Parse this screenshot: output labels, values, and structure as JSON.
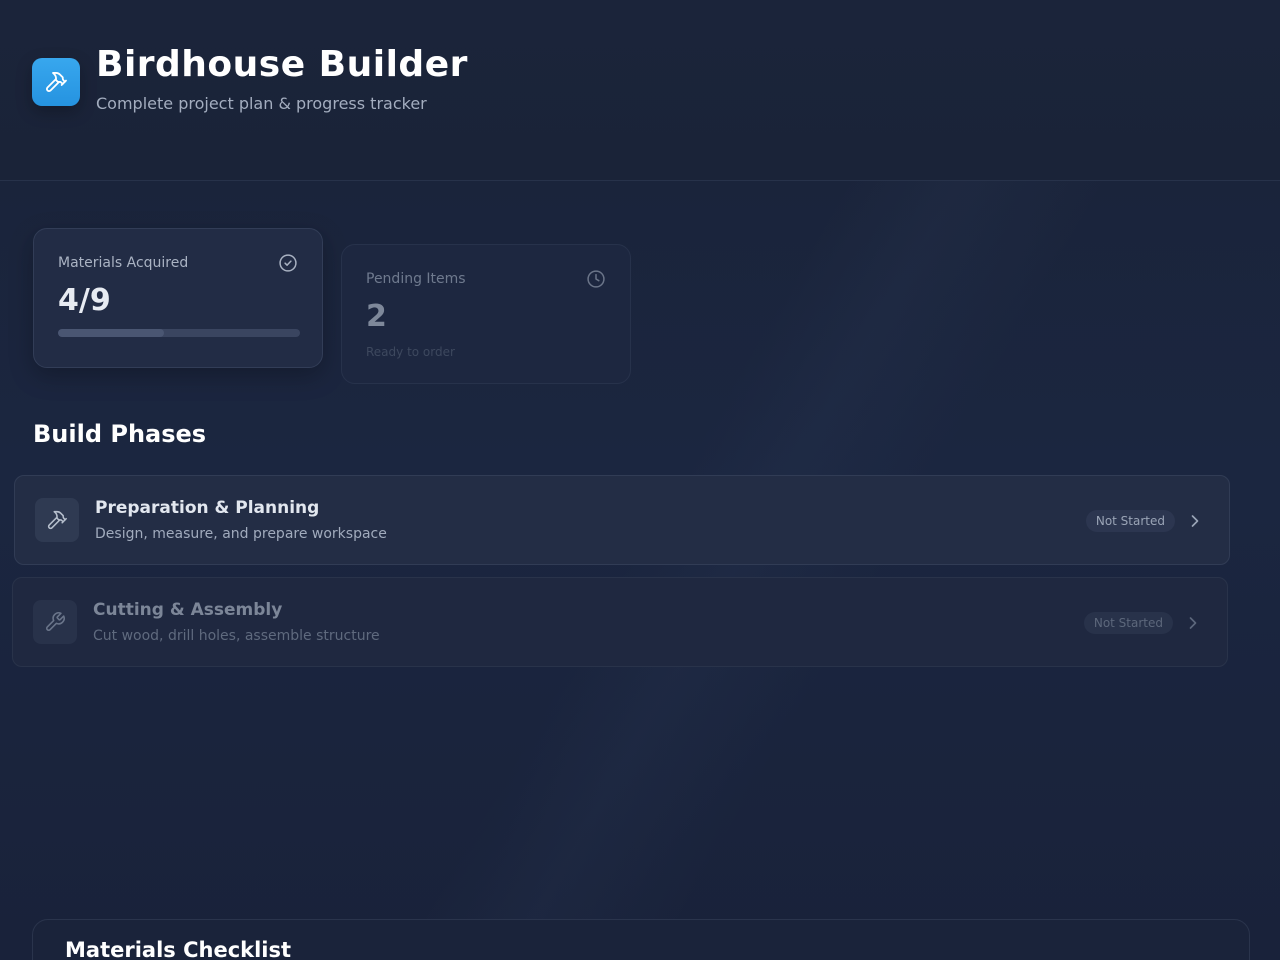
{
  "header": {
    "title": "Birdhouse Builder",
    "subtitle": "Complete project plan & progress tracker",
    "logo_icon": "hammer-icon"
  },
  "stats": {
    "materials": {
      "label": "Materials Acquired",
      "value": "4/9",
      "progress": 0.44,
      "icon": "check-circle-icon"
    },
    "pending": {
      "label": "Pending Items",
      "value": "2",
      "note": "Ready to order",
      "icon": "clock-icon"
    }
  },
  "phases_section": {
    "title": "Build Phases",
    "items": [
      {
        "title": "Preparation & Planning",
        "description": "Design, measure, and prepare workspace",
        "status": "Not Started",
        "icon": "hammer-icon"
      },
      {
        "title": "Cutting & Assembly",
        "description": "Cut wood, drill holes, assemble structure",
        "status": "Not Started",
        "icon": "wrench-icon"
      }
    ]
  },
  "materials_section": {
    "title": "Materials Checklist"
  },
  "colors": {
    "accent": "#2f9de8",
    "background": "#19223a",
    "card": "#222c45"
  }
}
